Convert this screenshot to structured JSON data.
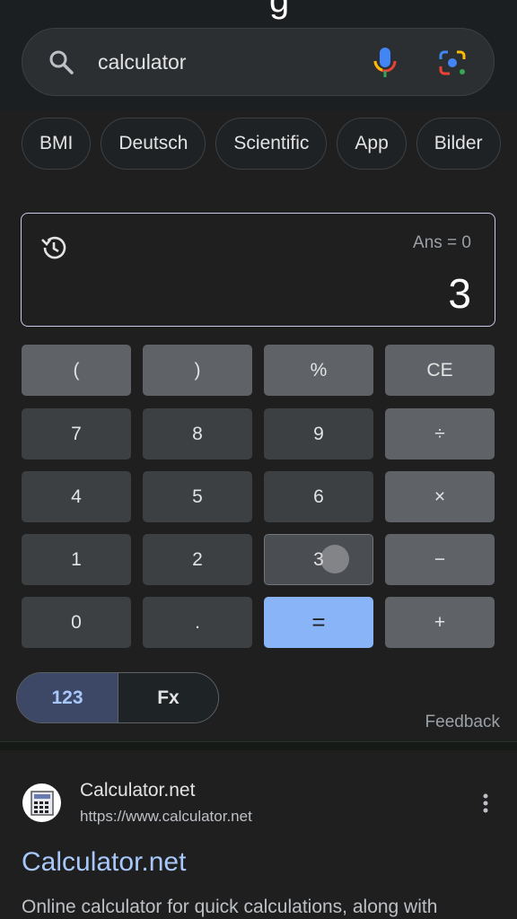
{
  "header": {
    "logo_fragment": "g"
  },
  "search": {
    "query": "calculator",
    "icons": [
      "search-icon",
      "microphone-icon",
      "lens-camera-icon"
    ]
  },
  "chips": [
    "BMI",
    "Deutsch",
    "Scientific",
    "App",
    "Bilder"
  ],
  "calculator": {
    "ans": "Ans = 0",
    "display": "3",
    "keys": [
      [
        "(",
        ")",
        "%",
        "CE"
      ],
      [
        "7",
        "8",
        "9",
        "÷"
      ],
      [
        "4",
        "5",
        "6",
        "×"
      ],
      [
        "1",
        "2",
        "3",
        "−"
      ],
      [
        "0",
        ".",
        "=",
        "+"
      ]
    ],
    "pressed_key": "3",
    "mode_toggle": {
      "options": [
        "123",
        "Fx"
      ],
      "selected": "123"
    },
    "feedback": "Feedback",
    "colors": {
      "equals": "#8ab4f8",
      "operator": "#5f6368",
      "digit": "#3c4043"
    }
  },
  "result": {
    "site_name": "Calculator.net",
    "url": "https://www.calculator.net",
    "title": "Calculator.net",
    "description": "Online calculator for quick calculations, along with"
  }
}
